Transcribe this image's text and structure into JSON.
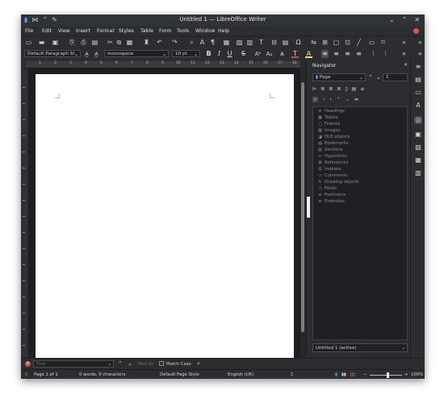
{
  "window": {
    "title": "Untitled 1 — LibreOffice Writer",
    "title_icons": [
      "writer-doc-icon",
      "pin-icon",
      "keep-above-icon",
      "settings-icon"
    ],
    "controls": [
      "minimize",
      "maximize",
      "close"
    ]
  },
  "menubar": [
    "File",
    "Edit",
    "View",
    "Insert",
    "Format",
    "Styles",
    "Table",
    "Form",
    "Tools",
    "Window",
    "Help"
  ],
  "formatting": {
    "paragraph_style": "Default Paragraph St",
    "font_name": "monospace",
    "font_size": "10 pt"
  },
  "ruler_numbers": [
    "1",
    "2",
    "3",
    "4",
    "5",
    "6",
    "7",
    "8",
    "9",
    "10",
    "11",
    "12",
    "13",
    "14",
    "15",
    "16",
    "17",
    "18"
  ],
  "navigator": {
    "title": "Navigator",
    "navigate_by": "Page",
    "page_number": "1",
    "items": [
      "Headings",
      "Tables",
      "Frames",
      "Images",
      "OLE objects",
      "Bookmarks",
      "Sections",
      "Hyperlinks",
      "References",
      "Indexes",
      "Comments",
      "Drawing objects",
      "Fields",
      "Footnotes",
      "Endnotes"
    ],
    "document": "Untitled 1 (active)"
  },
  "findbar": {
    "placeholder": "Find",
    "find_all": "Find All",
    "match_case": "Match Case"
  },
  "status": {
    "page": "Page 1 of 1",
    "words": "0 words, 0 characters",
    "page_style": "Default Page Style",
    "language": "English (UK)",
    "zoom": "100%"
  },
  "colors": {
    "window_bg": "#2b2d30",
    "page": "#ffffff",
    "close_red": "#d9534f",
    "highlight_yellow": "#f3e05a",
    "font_color_red": "#e2413c"
  }
}
